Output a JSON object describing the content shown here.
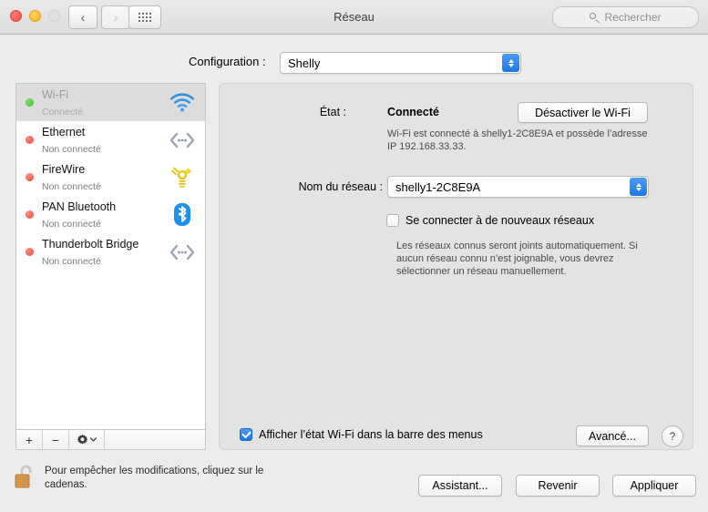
{
  "window": {
    "title": "Réseau",
    "traffic_lights": [
      "close",
      "minimize",
      "zoom"
    ],
    "nav_back": "‹",
    "nav_forward": "›",
    "grid_icon": "grid-icon"
  },
  "search": {
    "placeholder": "Rechercher",
    "icon": "search-icon"
  },
  "configuration": {
    "label": "Configuration :",
    "value": "Shelly"
  },
  "sidebar": {
    "items": [
      {
        "name": "Wi-Fi",
        "status": "Connecté",
        "dot": "green",
        "icon": "wifi-icon",
        "selected": true
      },
      {
        "name": "Ethernet",
        "status": "Non connecté",
        "dot": "red",
        "icon": "ethernet-icon",
        "selected": false
      },
      {
        "name": "FireWire",
        "status": "Non connecté",
        "dot": "red",
        "icon": "firewire-icon",
        "selected": false
      },
      {
        "name": "PAN Bluetooth",
        "status": "Non connecté",
        "dot": "red",
        "icon": "bluetooth-icon",
        "selected": false
      },
      {
        "name": "Thunderbolt Bridge",
        "status": "Non connecté",
        "dot": "red",
        "icon": "ethernet-icon",
        "selected": false
      }
    ],
    "toolbar": {
      "add": "+",
      "remove": "−",
      "gear": "gear-icon",
      "gear_chevron": "chevron-down-icon"
    }
  },
  "lock": {
    "icon": "unlocked-padlock-icon",
    "text": "Pour empêcher les modifications, cliquez sur le cadenas."
  },
  "panel": {
    "state_label": "État :",
    "state_value": "Connecté",
    "toggle_button": "Désactiver le Wi-Fi",
    "state_description": "Wi-Fi est connecté à shelly1-2C8E9A et possède l’adresse IP 192.168.33.33.",
    "network_label": "Nom du réseau :",
    "network_value": "shelly1-2C8E9A",
    "join_checkbox_label": "Se connecter à de nouveaux réseaux",
    "join_checked": false,
    "join_help": "Les réseaux connus seront joints automatiquement. Si aucun réseau connu n’est joignable, vous devrez sélectionner un réseau manuellement.",
    "menubar_checkbox_label": "Afficher l’état Wi-Fi dans la barre des menus",
    "menubar_checked": true,
    "advanced_button": "Avancé...",
    "help_button": "?"
  },
  "footer": {
    "assistant_button": "Assistant...",
    "revert_button": "Revenir",
    "apply_button": "Appliquer"
  },
  "colors": {
    "accent_blue": "#1c78e8",
    "connected_green": "#35c32c",
    "disconnected_red": "#f2493c",
    "firewire_yellow": "#e8c41e"
  }
}
